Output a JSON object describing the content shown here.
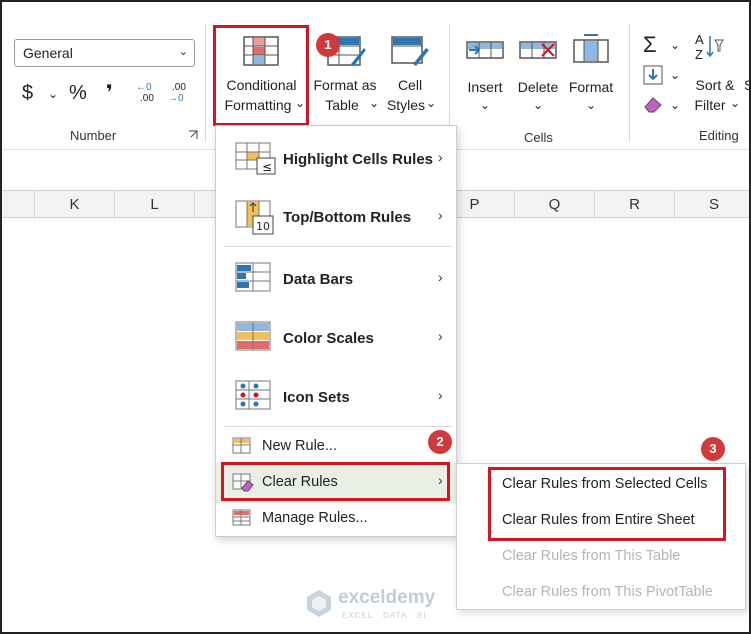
{
  "ribbon": {
    "number_format": "General",
    "number_group_label": "Number",
    "currency_symbol": "$",
    "percent_symbol": "%",
    "comma_symbol": "❜",
    "increase_decimal": ".00",
    "decrease_decimal": ".00",
    "decimal_arrow_left": "←0",
    "decimal_arrow_right": "→0",
    "conditional_formatting": {
      "line1": "Conditional",
      "line2": "Formatting"
    },
    "format_as_table": {
      "line1": "Format as",
      "line2": "Table"
    },
    "cell_styles": {
      "line1": "Cell",
      "line2": "Styles"
    },
    "insert": "Insert",
    "delete": "Delete",
    "format": "Format",
    "cells_group_label": "Cells",
    "sort_filter": {
      "line1": "Sort &",
      "line2": "Filter"
    },
    "editing_group_label": "Editing",
    "s_partial": "S"
  },
  "columns": [
    "K",
    "L",
    "P",
    "Q",
    "R",
    "S"
  ],
  "badges": [
    "1",
    "2",
    "3"
  ],
  "menu": {
    "items": [
      {
        "label": "Highlight Cells Rules"
      },
      {
        "label": "Top/Bottom Rules"
      },
      {
        "label": "Data Bars"
      },
      {
        "label": "Color Scales"
      },
      {
        "label": "Icon Sets"
      }
    ],
    "simple": [
      {
        "label": "New Rule..."
      },
      {
        "label": "Clear Rules"
      },
      {
        "label": "Manage Rules..."
      }
    ],
    "arrow": "›",
    "topbottom_icon_text": "10",
    "highlight_icon_text": "≤"
  },
  "submenu": {
    "items": [
      {
        "label": "Clear Rules from Selected Cells",
        "enabled": true
      },
      {
        "label": "Clear Rules from Entire Sheet",
        "enabled": true
      },
      {
        "label": "Clear Rules from This Table",
        "enabled": false
      },
      {
        "label": "Clear Rules from This PivotTable",
        "enabled": false
      }
    ]
  },
  "watermark": {
    "name": "exceldemy",
    "tagline": "EXCEL · DATA · BI"
  },
  "colors": {
    "accent_red": "#d2151e",
    "badge_red": "#d03a3a",
    "blue": "#2e75b6"
  }
}
